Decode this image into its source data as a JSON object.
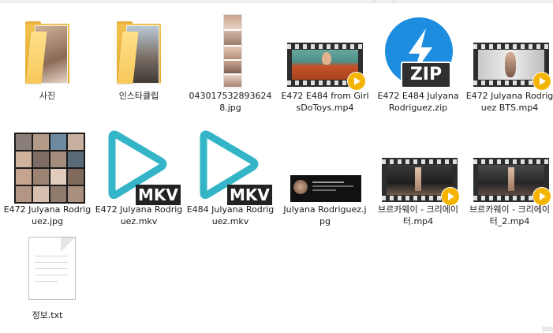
{
  "colors": {
    "folder": "#f2c14e",
    "zip_blue": "#1d8de0",
    "mkv_teal": "#33b5c7",
    "play_badge": "#f5b400"
  },
  "files": [
    {
      "name": "사진",
      "type": "folder",
      "icon": "folder-icon"
    },
    {
      "name": "인스타클립",
      "type": "folder",
      "icon": "folder-icon"
    },
    {
      "name": "0430175328936248.jpg",
      "type": "image",
      "icon": "image-thumbnail"
    },
    {
      "name": "E472 E484 from GirlsDoToys.mp4",
      "type": "video",
      "icon": "video-thumbnail"
    },
    {
      "name": "E472 E484 Julyana Rodriguez.zip",
      "type": "zip",
      "icon": "zip-icon"
    },
    {
      "name": "E472 Julyana Rodriguez BTS.mp4",
      "type": "video",
      "icon": "video-thumbnail"
    },
    {
      "name": "E472 Julyana Rodriguez.jpg",
      "type": "image",
      "icon": "image-thumbnail"
    },
    {
      "name": "E472 Julyana Rodriguez.mkv",
      "type": "mkv",
      "icon": "mkv-icon",
      "badge": "MKV"
    },
    {
      "name": "E484 Julyana Rodriguez.mkv",
      "type": "mkv",
      "icon": "mkv-icon",
      "badge": "MKV"
    },
    {
      "name": "Julyana Rodriguez.jpg",
      "type": "image",
      "icon": "image-thumbnail"
    },
    {
      "name": "브르카웨이 - 크리에이터.mp4",
      "type": "video",
      "icon": "video-thumbnail"
    },
    {
      "name": "브르카웨이 - 크리에이터_2.mp4",
      "type": "video",
      "icon": "video-thumbnail"
    },
    {
      "name": "정보.txt",
      "type": "text",
      "icon": "text-document-icon"
    }
  ],
  "zip_badge": "ZIP"
}
